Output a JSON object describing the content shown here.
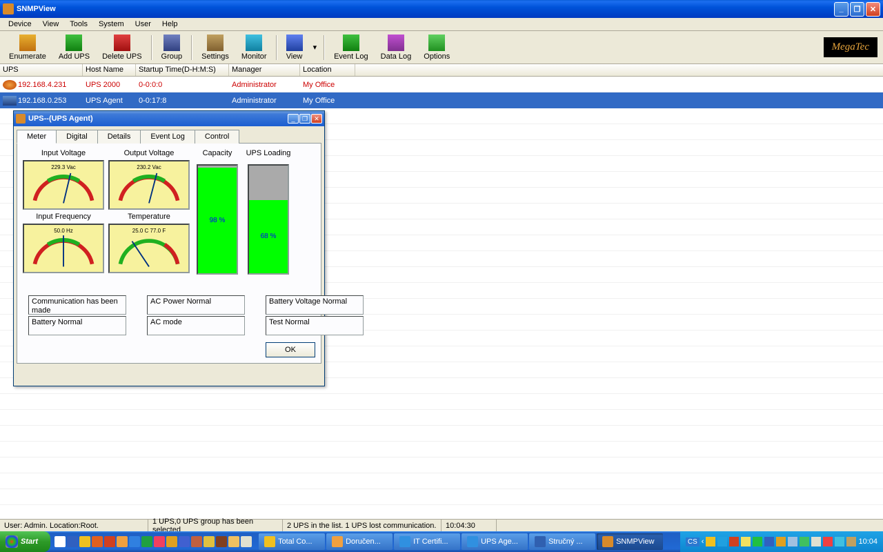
{
  "window": {
    "title": "SNMPView"
  },
  "menu": [
    "Device",
    "View",
    "Tools",
    "System",
    "User",
    "Help"
  ],
  "toolbar": {
    "enumerate": "Enumerate",
    "addups": "Add UPS",
    "deleteups": "Delete UPS",
    "group": "Group",
    "settings": "Settings",
    "monitor": "Monitor",
    "view": "View",
    "eventlog": "Event Log",
    "datalog": "Data Log",
    "options": "Options",
    "logo": "MegaTec"
  },
  "columns": {
    "ups": "UPS",
    "host": "Host Name",
    "startup": "Startup Time(D-H:M:S)",
    "manager": "Manager",
    "location": "Location"
  },
  "rows": [
    {
      "ip": "192.168.4.231",
      "host": "UPS 2000",
      "startup": "0-0:0:0",
      "manager": "Administrator",
      "location": "My Office",
      "error": true
    },
    {
      "ip": "192.168.0.253",
      "host": "UPS Agent",
      "startup": "0-0:17:8",
      "manager": "Administrator",
      "location": "My Office",
      "selected": true
    }
  ],
  "child": {
    "title": "UPS--(UPS Agent)",
    "tabs": [
      "Meter",
      "Digital",
      "Details",
      "Event Log",
      "Control"
    ],
    "meters": {
      "in_v_label": "Input Voltage",
      "in_v_val": "229.3 Vac",
      "out_v_label": "Output Voltage",
      "out_v_val": "230.2 Vac",
      "in_f_label": "Input Frequency",
      "in_f_val": "50.0 Hz",
      "temp_label": "Temperature",
      "temp_val": "25.0 C  77.0 F",
      "cap_label": "Capacity",
      "cap_pct": 98,
      "cap_txt": "98 %",
      "load_label": "UPS Loading",
      "load_pct": 68,
      "load_txt": "68 %"
    },
    "status": {
      "comm": "Communication has been made",
      "batt_n": "Battery Normal",
      "ac_n": "AC Power Normal",
      "ac_m": "AC mode",
      "bv_n": "Battery Voltage Normal",
      "test_n": "Test Normal"
    },
    "ok": "OK"
  },
  "statusbar": {
    "user": "User: Admin.  Location:Root.",
    "sel": "1 UPS,0 UPS group has been selected",
    "list": "2 UPS in the list. 1 UPS  lost communication.",
    "time": "10:04:30"
  },
  "taskbar": {
    "start": "Start",
    "tasks": [
      {
        "label": "Total Co...",
        "active": false
      },
      {
        "label": "Doručen...",
        "active": false
      },
      {
        "label": "IT Certifi...",
        "active": false
      },
      {
        "label": "UPS Age...",
        "active": false
      },
      {
        "label": "Stručný ...",
        "active": false
      },
      {
        "label": "SNMPView",
        "active": true
      }
    ],
    "lang": "CS",
    "clock": "10:04"
  }
}
